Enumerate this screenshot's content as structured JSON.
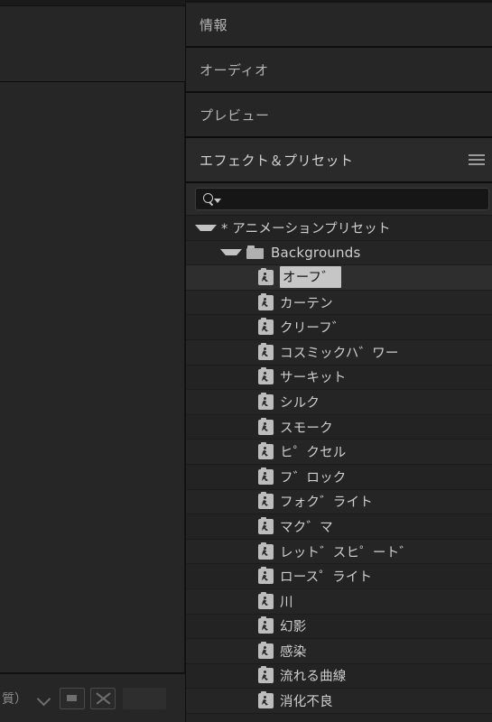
{
  "window": {
    "app": "Adobe After Effects",
    "background_color": "#232323"
  },
  "left_panel": {
    "bottom_bar": {
      "quality_label": "質）",
      "chevron_icon": "chevron-down-icon",
      "button_1_icon": "region-of-interest-icon",
      "button_2_icon": "transparency-grid-icon"
    }
  },
  "right_panel": {
    "tabs": [
      {
        "label": "情報",
        "active": false,
        "has_menu": false
      },
      {
        "label": "オーディオ",
        "active": false,
        "has_menu": false
      },
      {
        "label": "プレビュー",
        "active": false,
        "has_menu": false
      },
      {
        "label": "エフェクト＆プリセット",
        "active": true,
        "has_menu": true,
        "menu_icon": "hamburger-menu-icon"
      }
    ],
    "search": {
      "icon": "search-icon",
      "dropdown_icon": "caret-down-icon",
      "value": "",
      "placeholder": ""
    },
    "tree": {
      "root": {
        "label": "* アニメーションプリセット",
        "expanded": true,
        "disclosure_icon": "triangle-down-icon",
        "marker": "*"
      },
      "folder": {
        "label": "Backgrounds",
        "expanded": true,
        "disclosure_icon": "triangle-down-icon",
        "icon": "folder-icon"
      },
      "items": [
        {
          "label": "オーフ゛",
          "icon": "animation-preset-icon",
          "selected": true
        },
        {
          "label": "カーテン",
          "icon": "animation-preset-icon",
          "selected": false
        },
        {
          "label": "クリーフ゛",
          "icon": "animation-preset-icon",
          "selected": false
        },
        {
          "label": "コスミックハ゛ワー",
          "icon": "animation-preset-icon",
          "selected": false
        },
        {
          "label": "サーキット",
          "icon": "animation-preset-icon",
          "selected": false
        },
        {
          "label": "シルク",
          "icon": "animation-preset-icon",
          "selected": false
        },
        {
          "label": "スモーク",
          "icon": "animation-preset-icon",
          "selected": false
        },
        {
          "label": "ヒ゜クセル",
          "icon": "animation-preset-icon",
          "selected": false
        },
        {
          "label": "フ゛ロック",
          "icon": "animation-preset-icon",
          "selected": false
        },
        {
          "label": "フォク゛ライト",
          "icon": "animation-preset-icon",
          "selected": false
        },
        {
          "label": "マク゛マ",
          "icon": "animation-preset-icon",
          "selected": false
        },
        {
          "label": "レット゛スヒ゜ート゛",
          "icon": "animation-preset-icon",
          "selected": false
        },
        {
          "label": "ロース゜ライト",
          "icon": "animation-preset-icon",
          "selected": false
        },
        {
          "label": "川",
          "icon": "animation-preset-icon",
          "selected": false
        },
        {
          "label": "幻影",
          "icon": "animation-preset-icon",
          "selected": false
        },
        {
          "label": "感染",
          "icon": "animation-preset-icon",
          "selected": false
        },
        {
          "label": "流れる曲線",
          "icon": "animation-preset-icon",
          "selected": false
        },
        {
          "label": "消化不良",
          "icon": "animation-preset-icon",
          "selected": false
        }
      ]
    }
  },
  "colors": {
    "panel_bg": "#232323",
    "tab_bg": "#262626",
    "active_tab_bg": "#2a2a2a",
    "selected_row_bg": "#2e2e2e",
    "selection_highlight": "#c6c6c6",
    "text": "#cfcfcf",
    "muted_text": "#9a9a9a",
    "icon_light": "#bdbdbd",
    "search_field_bg": "#161616",
    "divider": "#0d0d0d"
  }
}
